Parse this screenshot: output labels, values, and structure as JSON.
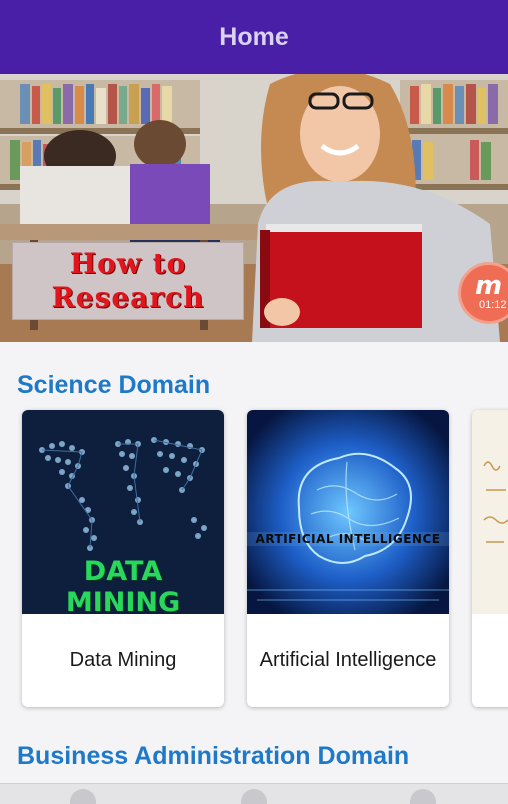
{
  "appbar": {
    "title": "Home"
  },
  "banner": {
    "sign_line1": "How to",
    "sign_line2": "Research",
    "video_badge": {
      "logo": "m",
      "time": "01:12"
    },
    "slide_count": 2,
    "active_slide": 2
  },
  "sections": [
    {
      "title": "Science Domain",
      "cards": [
        {
          "label": "Data Mining",
          "image_text": "DATA MINING",
          "icon": "world-map-image"
        },
        {
          "label": "Artificial Intelligence",
          "image_text": "ARTIFICIAL INTELLIGENCE",
          "icon": "brain-image"
        },
        {
          "label": "",
          "image_text": "",
          "icon": "handwritten-notes-image"
        }
      ]
    },
    {
      "title": "Business Administration Domain"
    }
  ],
  "colors": {
    "appbar": "#4a1fa8",
    "section_title": "#1e79c8",
    "card_bg": "#ffffff"
  }
}
